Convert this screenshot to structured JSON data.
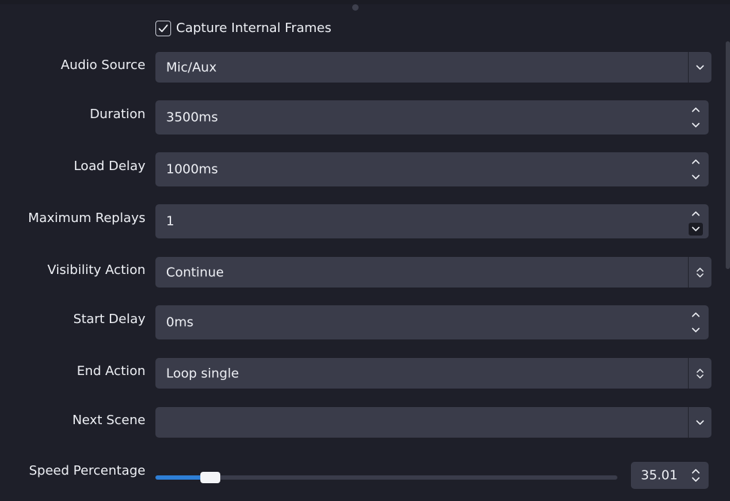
{
  "capture_internal_frames": {
    "label": "Capture Internal Frames",
    "checked": true
  },
  "audio_source": {
    "label": "Audio Source",
    "value": "Mic/Aux"
  },
  "duration": {
    "label": "Duration",
    "value": "3500ms"
  },
  "load_delay": {
    "label": "Load Delay",
    "value": "1000ms"
  },
  "maximum_replays": {
    "label": "Maximum Replays",
    "value": "1"
  },
  "visibility_action": {
    "label": "Visibility Action",
    "value": "Continue"
  },
  "start_delay": {
    "label": "Start Delay",
    "value": "0ms"
  },
  "end_action": {
    "label": "End Action",
    "value": "Loop single"
  },
  "next_scene": {
    "label": "Next Scene",
    "value": ""
  },
  "speed_percentage": {
    "label": "Speed Percentage",
    "value": "35.01",
    "slider_fraction": 0.1
  },
  "colors": {
    "background": "#1e1f29",
    "field": "#3a3c4a",
    "accent": "#2e7fd6",
    "text": "#eef0f5"
  },
  "icons": {
    "check": "checkmark-icon",
    "dropdown": "chevron-down-icon",
    "up": "chevron-up-icon",
    "updown": "chevron-updown-icon"
  }
}
